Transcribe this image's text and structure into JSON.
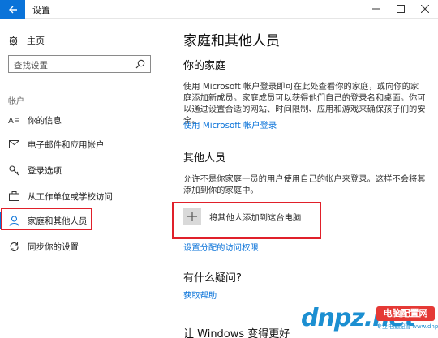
{
  "titlebar": {
    "title": "设置"
  },
  "sidebar": {
    "home_label": "主页",
    "search_placeholder": "查找设置",
    "section_label": "帐户",
    "items": [
      {
        "label": "你的信息",
        "icon": "person-card-icon"
      },
      {
        "label": "电子邮件和应用帐户",
        "icon": "mail-icon"
      },
      {
        "label": "登录选项",
        "icon": "key-icon"
      },
      {
        "label": "从工作单位或学校访问",
        "icon": "briefcase-icon"
      },
      {
        "label": "家庭和其他人员",
        "icon": "people-icon",
        "active": true
      },
      {
        "label": "同步你的设置",
        "icon": "sync-icon"
      }
    ]
  },
  "main": {
    "title": "家庭和其他人员",
    "family": {
      "heading": "你的家庭",
      "description": "使用 Microsoft 帐户登录即可在此处查看你的家庭，或向你的家庭添加新成员。家庭成员可以获得他们自己的登录名和桌面。你可以通过设置合适的网站、时间限制、应用和游戏来确保孩子们的安全。",
      "link": "使用 Microsoft 帐户登录"
    },
    "others": {
      "heading": "其他人员",
      "description": "允许不是你家庭一员的用户使用自己的帐户来登录。这样不会将其添加到你的家庭中。",
      "add_button": "将其他人添加到这台电脑",
      "link": "设置分配的访问权限"
    },
    "question": {
      "heading": "有什么疑问?",
      "link": "获取帮助"
    },
    "bottom_heading": "让 Windows 变得更好"
  },
  "watermark": {
    "logo": "dnpz.net",
    "badge": "电脑配置网",
    "sub": "专业电脑配置 www.dnpz.net"
  },
  "colors": {
    "accent": "#0a73d9",
    "highlight": "#e0202a"
  }
}
